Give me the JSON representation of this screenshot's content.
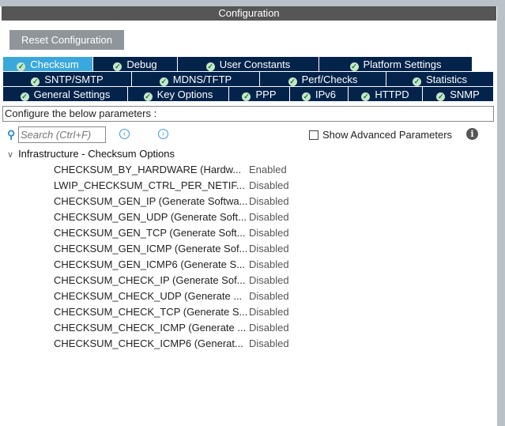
{
  "title": "Configuration",
  "reset_label": "Reset Configuration",
  "tabs": {
    "row1": [
      "Checksum",
      "Debug",
      "User Constants",
      "Platform Settings"
    ],
    "row2": [
      "SNTP/SMTP",
      "MDNS/TFTP",
      "Perf/Checks",
      "Statistics"
    ],
    "row3": [
      "General Settings",
      "Key Options",
      "PPP",
      "IPv6",
      "HTTPD",
      "SNMP"
    ]
  },
  "active_tab": "Checksum",
  "configure_label": "Configure the below parameters :",
  "search_placeholder": "Search (Ctrl+F)",
  "show_advanced_label": "Show Advanced Parameters",
  "group": "Infrastructure - Checksum Options",
  "params": [
    {
      "name": "CHECKSUM_BY_HARDWARE (Hardw...",
      "value": "Enabled"
    },
    {
      "name": "LWIP_CHECKSUM_CTRL_PER_NETIF...",
      "value": "Disabled"
    },
    {
      "name": "CHECKSUM_GEN_IP (Generate Softwa...",
      "value": "Disabled"
    },
    {
      "name": "CHECKSUM_GEN_UDP (Generate Soft...",
      "value": "Disabled"
    },
    {
      "name": "CHECKSUM_GEN_TCP (Generate Soft...",
      "value": "Disabled"
    },
    {
      "name": "CHECKSUM_GEN_ICMP (Generate Sof...",
      "value": "Disabled"
    },
    {
      "name": "CHECKSUM_GEN_ICMP6 (Generate S...",
      "value": "Disabled"
    },
    {
      "name": "CHECKSUM_CHECK_IP (Generate Sof...",
      "value": "Disabled"
    },
    {
      "name": "CHECKSUM_CHECK_UDP (Generate ...",
      "value": "Disabled"
    },
    {
      "name": "CHECKSUM_CHECK_TCP (Generate S...",
      "value": "Disabled"
    },
    {
      "name": "CHECKSUM_CHECK_ICMP (Generate ...",
      "value": "Disabled"
    },
    {
      "name": "CHECKSUM_CHECK_ICMP6 (Generat...",
      "value": "Disabled"
    }
  ]
}
